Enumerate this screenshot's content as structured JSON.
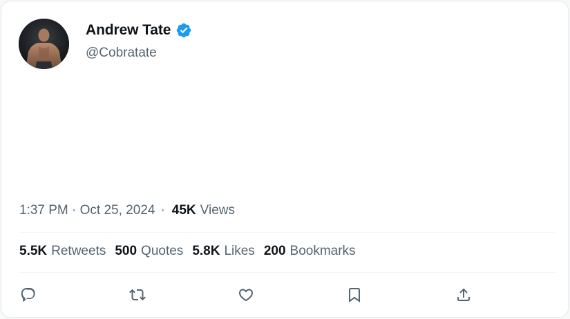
{
  "author": {
    "display_name": "Andrew Tate",
    "handle": "@Cobratate",
    "verified": true
  },
  "meta": {
    "time": "1:37 PM",
    "date": "Oct 25, 2024",
    "separator": "·",
    "time_date_separator": " · ",
    "views_count": "45K",
    "views_label": "Views"
  },
  "stats": [
    {
      "count": "5.5K",
      "label": "Retweets"
    },
    {
      "count": "500",
      "label": "Quotes"
    },
    {
      "count": "5.8K",
      "label": "Likes"
    },
    {
      "count": "200",
      "label": "Bookmarks"
    }
  ],
  "actions": {
    "reply": "reply-icon",
    "retweet": "retweet-icon",
    "like": "heart-icon",
    "bookmark": "bookmark-icon",
    "share": "share-icon"
  },
  "colors": {
    "text_primary": "#0f1419",
    "text_secondary": "#536471",
    "verified_blue": "#1d9bf0",
    "divider": "#eff3f4"
  }
}
